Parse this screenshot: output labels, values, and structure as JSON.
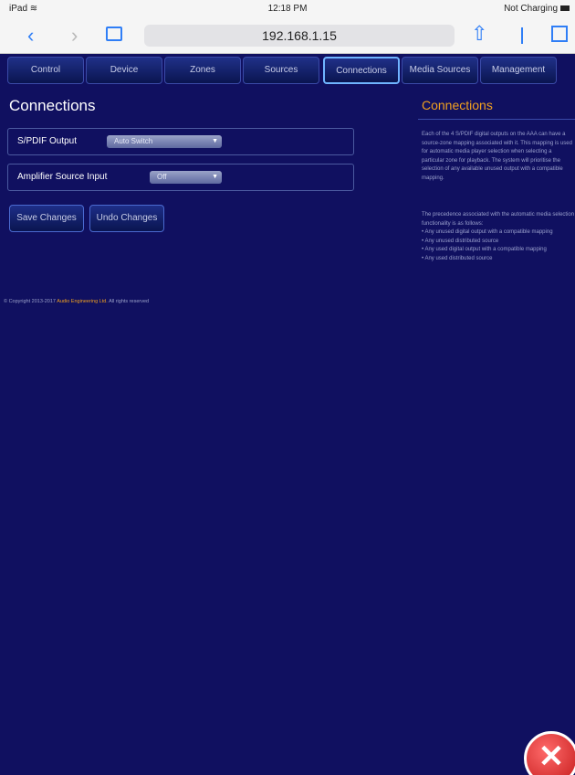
{
  "status_bar": {
    "device": "iPad",
    "time": "12:18 PM",
    "charging": "Not Charging"
  },
  "browser": {
    "url": "192.168.1.15",
    "back_icon": "chevron-left",
    "forward_icon": "chevron-right",
    "reload_icon": "reload"
  },
  "nav": {
    "tabs": [
      "Control",
      "Device",
      "Zones",
      "Sources",
      "Connections",
      "Media Sources",
      "Management"
    ],
    "active": "Connections"
  },
  "main": {
    "title": "Connections",
    "spdif": {
      "label": "S/PDIF Output",
      "value": "Auto Switch"
    },
    "amp": {
      "label": "Amplifier Source Input",
      "value": "Off"
    },
    "save_label": "Save Changes",
    "undo_label": "Undo Changes"
  },
  "footer": {
    "copyright_prefix": "© Copyright 2013-2017",
    "company": "Audio Engineering Ltd.",
    "rights": "All rights reserved"
  },
  "help": {
    "title": "Connections",
    "para1": "Each of the 4 S/PDIF digital outputs on the AAA can have a source-zone mapping associated with it. This mapping is used for automatic media player selection when selecting a particular zone for playback. The system will prioritise the selection of any available unused output with a compatible mapping.",
    "para2": "The precedence associated with the automatic media selection functionality is as follows:",
    "list": [
      "Any unused digital output with a compatible mapping",
      "Any unused distributed source",
      "Any used digital output with a compatible mapping",
      "Any used distributed source"
    ]
  },
  "colors": {
    "background": "#101060",
    "accent": "#f0a020",
    "close": "#d42020"
  }
}
